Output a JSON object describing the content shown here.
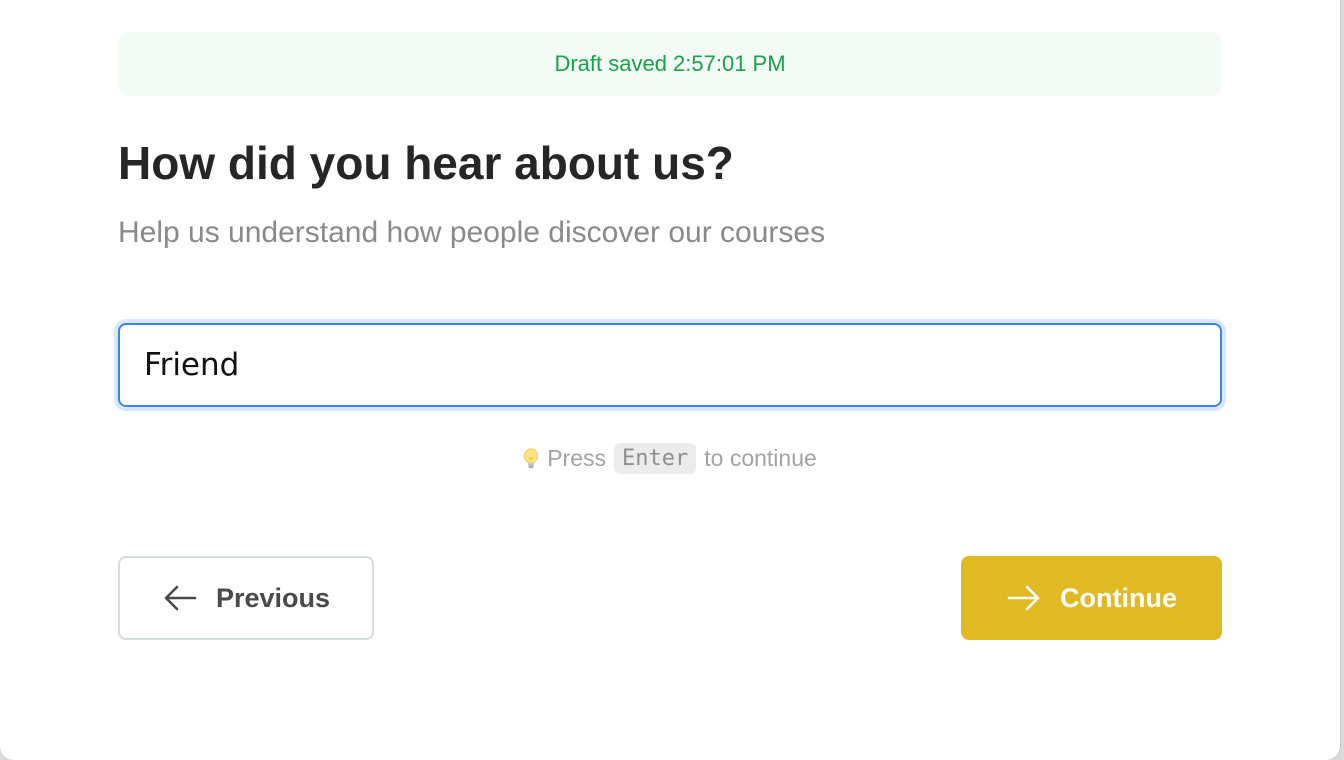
{
  "draft_banner": {
    "text": "Draft saved 2:57:01 PM",
    "color": "#16a34a"
  },
  "question": {
    "title": "How did you hear about us?",
    "subtitle": "Help us understand how people discover our courses"
  },
  "answer": {
    "value": "Friend",
    "placeholder": ""
  },
  "hint": {
    "icon": "lightbulb-icon",
    "prefix": "Press",
    "key": "Enter",
    "suffix": "to continue"
  },
  "navigation": {
    "previous_label": "Previous",
    "previous_icon": "arrow-left-icon",
    "continue_label": "Continue",
    "continue_icon": "arrow-right-icon",
    "accent_color": "#e1ba23",
    "focus_color": "#3b82f6"
  }
}
